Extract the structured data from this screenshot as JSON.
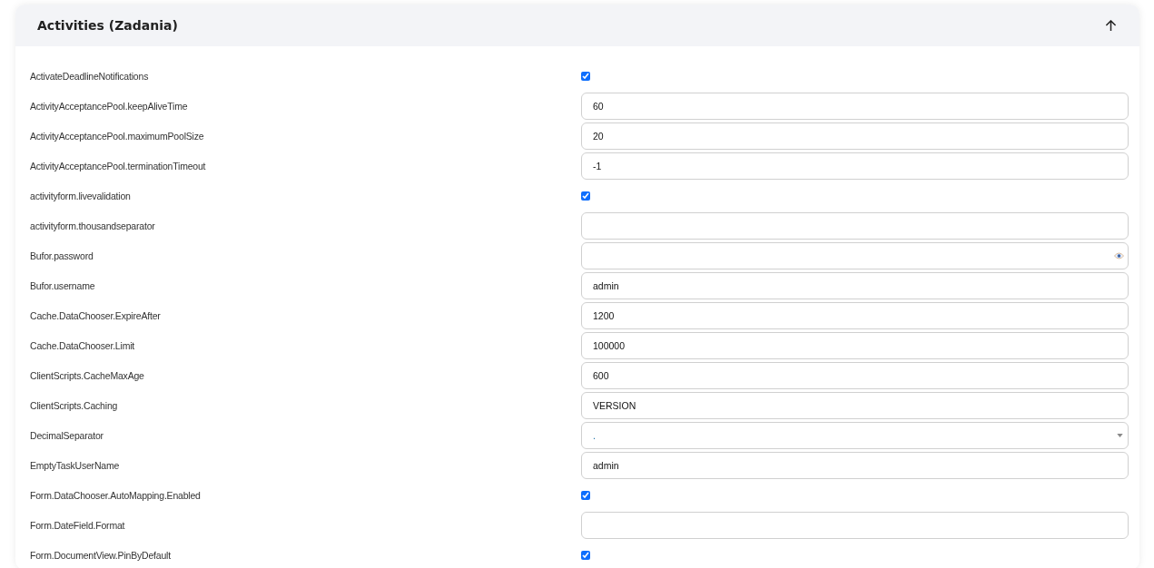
{
  "panel": {
    "title": "Activities (Zadania)",
    "expanded": true
  },
  "settings": [
    {
      "label": "ActivateDeadlineNotifications",
      "kind": "checkbox",
      "checked": true
    },
    {
      "label": "ActivityAcceptancePool.keepAliveTime",
      "kind": "text",
      "value": "60"
    },
    {
      "label": "ActivityAcceptancePool.maximumPoolSize",
      "kind": "text",
      "value": "20"
    },
    {
      "label": "ActivityAcceptancePool.terminationTimeout",
      "kind": "text",
      "value": "-1"
    },
    {
      "label": "activityform.livevalidation",
      "kind": "checkbox",
      "checked": true
    },
    {
      "label": "activityform.thousandseparator",
      "kind": "text"
    },
    {
      "label": "Bufor.password",
      "kind": "password"
    },
    {
      "label": "Bufor.username",
      "kind": "text",
      "value": "admin"
    },
    {
      "label": "Cache.DataChooser.ExpireAfter",
      "kind": "text",
      "value": "1200"
    },
    {
      "label": "Cache.DataChooser.Limit",
      "kind": "text",
      "value": "100000"
    },
    {
      "label": "ClientScripts.CacheMaxAge",
      "kind": "text",
      "value": "600"
    },
    {
      "label": "ClientScripts.Caching",
      "kind": "text",
      "value": "VERSION"
    },
    {
      "label": "DecimalSeparator",
      "kind": "select",
      "value": "."
    },
    {
      "label": "EmptyTaskUserName",
      "kind": "text",
      "value": "admin"
    },
    {
      "label": "Form.DataChooser.AutoMapping.Enabled",
      "kind": "checkbox",
      "checked": true
    },
    {
      "label": "Form.DateField.Format",
      "kind": "text"
    },
    {
      "label": "Form.DocumentView.PinByDefault",
      "kind": "checkbox",
      "checked": true
    }
  ]
}
